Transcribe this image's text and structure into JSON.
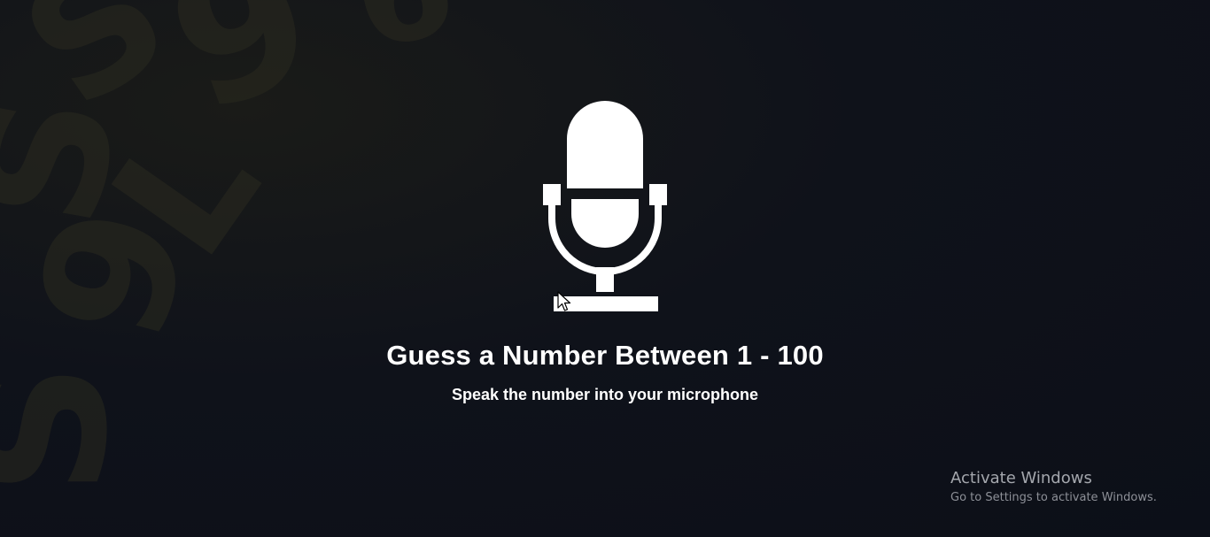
{
  "background": {
    "digits": [
      "S",
      "9",
      "S",
      "L",
      "9",
      "S",
      "6"
    ],
    "colors": {
      "bg": "#0f121a",
      "digit": "#2a2a1f"
    }
  },
  "main": {
    "icon": "microphone-icon",
    "title": "Guess a Number Between 1 - 100",
    "subtitle": "Speak the number into your microphone"
  },
  "cursor": {
    "icon": "mouse-pointer-icon"
  },
  "watermark": {
    "title": "Activate Windows",
    "subtitle": "Go to Settings to activate Windows."
  }
}
